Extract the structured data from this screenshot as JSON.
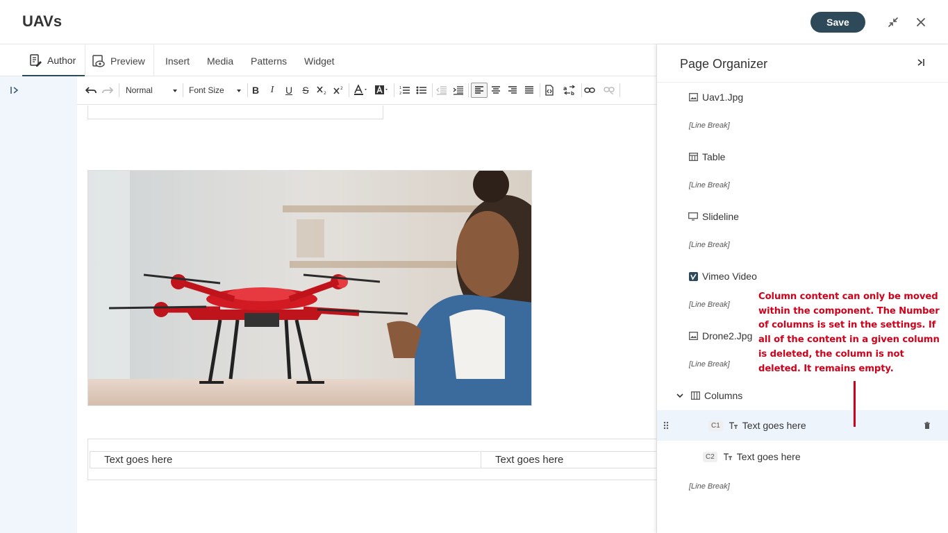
{
  "header": {
    "title": "UAVs",
    "save_label": "Save"
  },
  "tabs": {
    "author": "Author",
    "preview": "Preview",
    "insert": "Insert",
    "media": "Media",
    "patterns": "Patterns",
    "widget": "Widget"
  },
  "toolbar": {
    "format_value": "Normal",
    "font_size_value": "Font Size",
    "bold": "B",
    "italic": "I",
    "underline": "U",
    "strike": "S"
  },
  "canvas": {
    "col1_text": "Text goes here",
    "col2_text": "Text goes here"
  },
  "organizer": {
    "title": "Page Organizer",
    "items": [
      {
        "label": "Uav1.Jpg",
        "icon": "image-icon"
      },
      {
        "label": "[Line Break]"
      },
      {
        "label": "Table",
        "icon": "table-icon"
      },
      {
        "label": "[Line Break]"
      },
      {
        "label": "Slideline",
        "icon": "slideshow-icon"
      },
      {
        "label": "[Line Break]"
      },
      {
        "label": "Vimeo Video",
        "icon": "vimeo-icon"
      },
      {
        "label": "[Line Break]"
      },
      {
        "label": "Drone2.Jpg",
        "icon": "image-icon"
      },
      {
        "label": "[Line Break]"
      },
      {
        "label": "Columns",
        "icon": "columns-icon"
      },
      {
        "badge": "C1",
        "label": "Text goes here"
      },
      {
        "badge": "C2",
        "label": "Text goes here"
      },
      {
        "label": "[Line Break]"
      }
    ]
  },
  "annotation": {
    "text": "Column content can only be moved within the component. The Number of columns is set in the settings. If all of the content in a given column is deleted, the column is not deleted. It remains empty."
  },
  "colors": {
    "accent": "#2e4a5a",
    "annotation_red": "#d0021b",
    "rail_bg": "#f1f6fc",
    "selected_bg": "#eef4fb"
  }
}
